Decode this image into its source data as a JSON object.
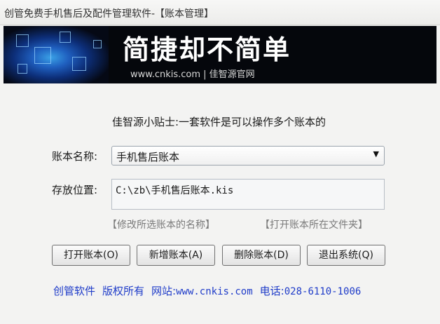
{
  "window": {
    "title": "创管免费手机售后及配件管理软件-【账本管理】"
  },
  "banner": {
    "slogan": "简捷却不简单",
    "site": "www.cnkis.com | 佳智源官网"
  },
  "tip": "佳智源小贴士:一套软件是可以操作多个账本的",
  "form": {
    "name_label": "账本名称:",
    "name_value": "手机售后账本",
    "path_label": "存放位置:",
    "path_value": "C:\\zb\\手机售后账本.kis"
  },
  "links": {
    "rename": "【修改所选账本的名称】",
    "open_folder": "【打开账本所在文件夹】"
  },
  "buttons": {
    "open": "打开账本(O)",
    "add": "新增账本(A)",
    "delete": "删除账本(D)",
    "exit": "退出系统(Q)"
  },
  "footer": {
    "company": "创管软件",
    "copyright": "版权所有",
    "site_label": "网站:",
    "site": "www.cnkis.com",
    "phone_label": "电话:",
    "phone": "028-6110-1006"
  }
}
